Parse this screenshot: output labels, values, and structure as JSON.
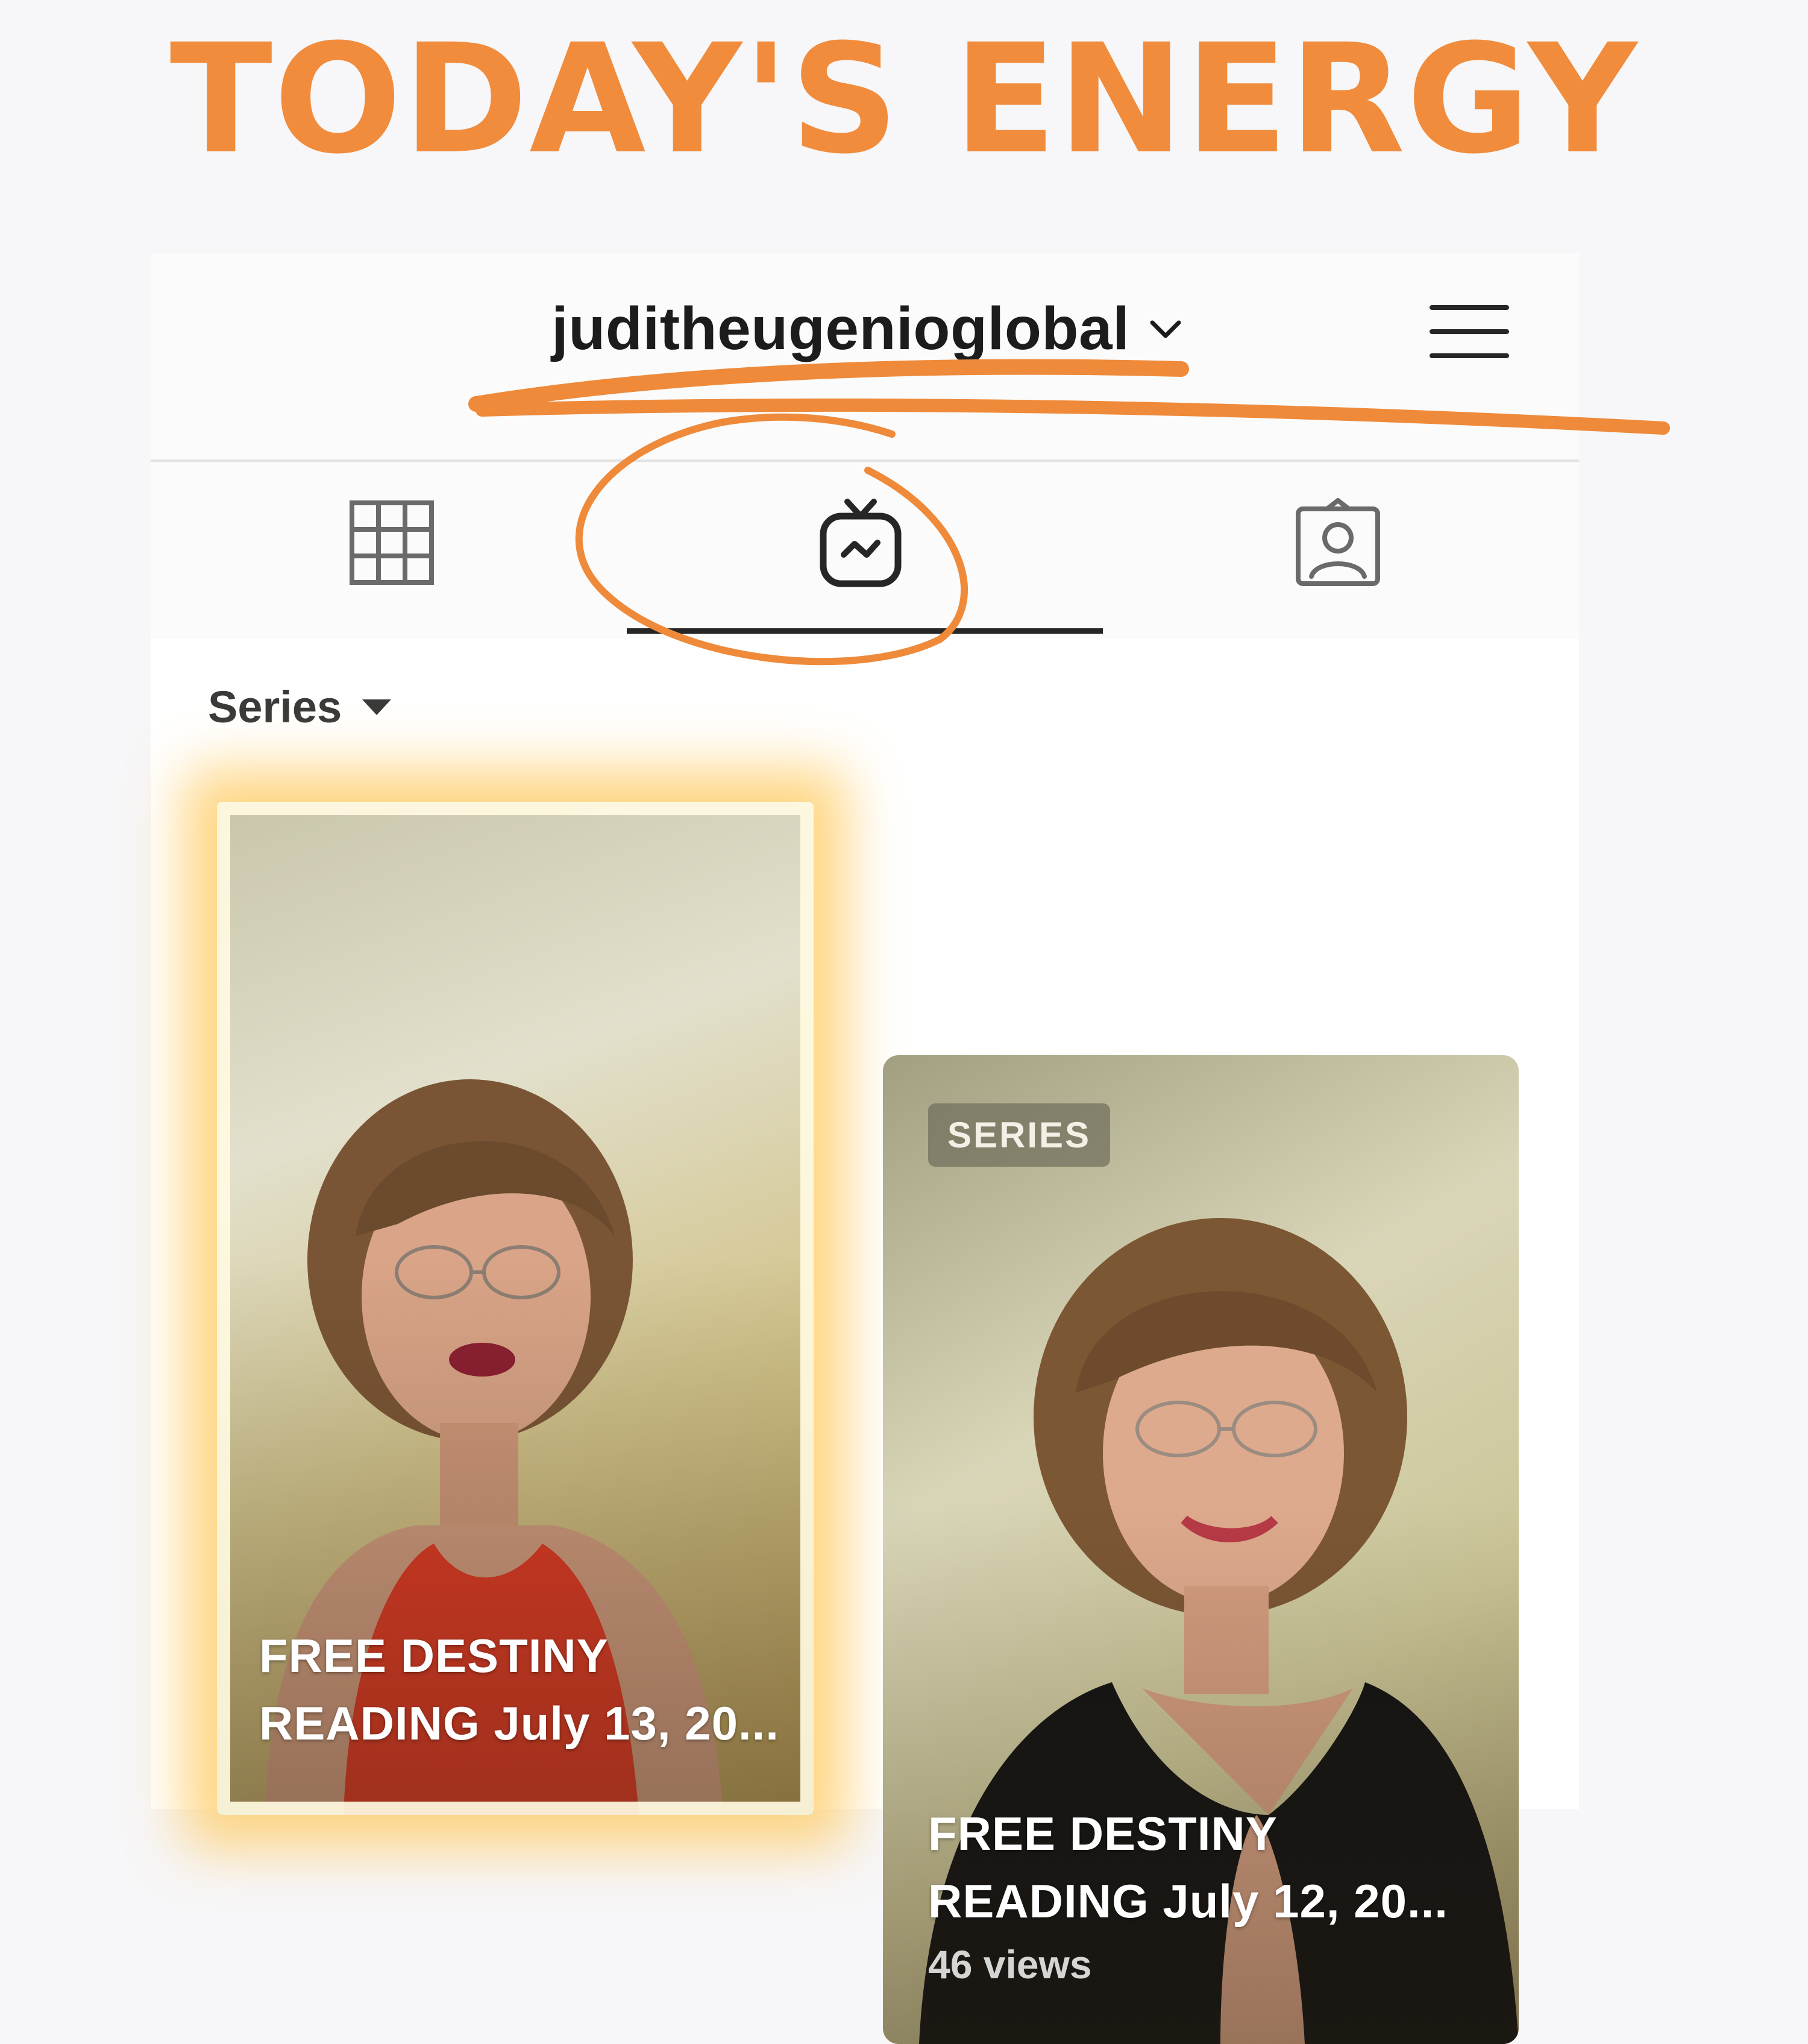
{
  "title": "TODAY'S ENERGY",
  "colors": {
    "title": "#f08c3c",
    "annotation": "#ee8a3a",
    "tab_active": "#262626",
    "highlight_glow": "#ffc85a"
  },
  "profile": {
    "username": "juditheugenioglobal"
  },
  "icons": {
    "username_dropdown": "chevron-down-icon",
    "menu": "hamburger-menu-icon",
    "tab_grid": "grid-icon",
    "tab_igtv": "igtv-icon",
    "tab_tagged": "tagged-person-icon",
    "series_dropdown": "caret-down-icon"
  },
  "tabs": {
    "active": "igtv"
  },
  "filter": {
    "label": "Series"
  },
  "videos": [
    {
      "caption_line1": "FREE DESTINY",
      "caption_line2": "READING July 13, 20...",
      "highlighted": true
    },
    {
      "badge": "SERIES",
      "caption_line1": "FREE DESTINY",
      "caption_line2": "READING July 12, 20...",
      "views": "46 views"
    }
  ]
}
